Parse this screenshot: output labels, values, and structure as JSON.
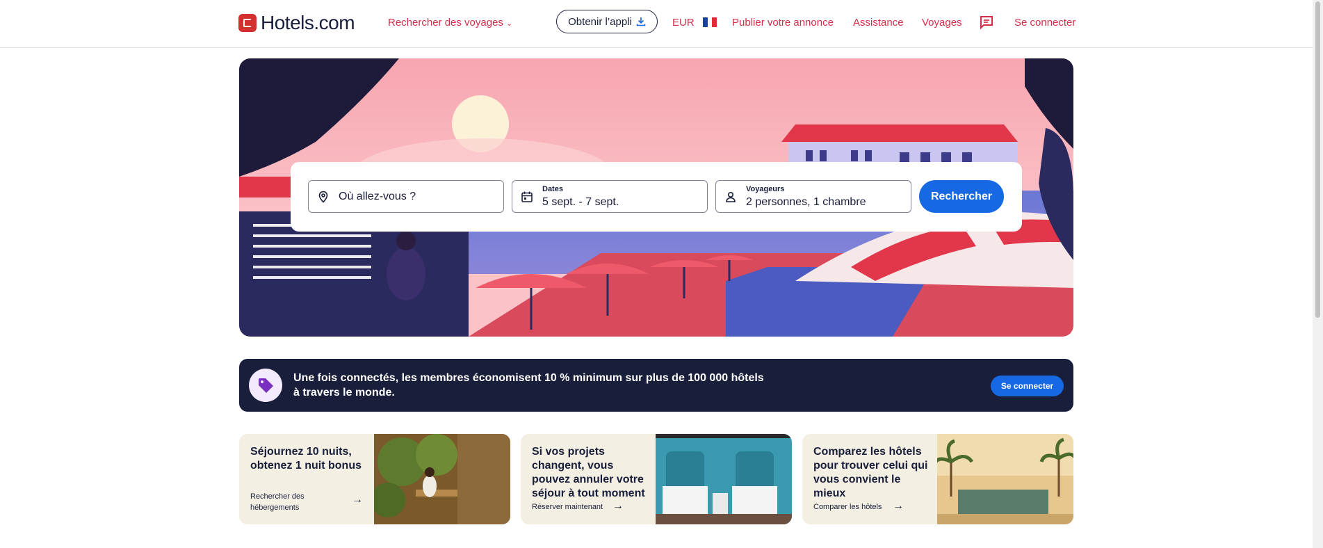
{
  "header": {
    "logo_text": "Hotels.com",
    "search_trips": "Rechercher des voyages",
    "get_app": "Obtenir l’appli",
    "currency": "EUR",
    "list_property": "Publier votre annonce",
    "support": "Assistance",
    "trips": "Voyages",
    "sign_in": "Se connecter"
  },
  "search": {
    "destination_placeholder": "Où allez-vous ?",
    "dates_label": "Dates",
    "dates_value": "5 sept. - 7 sept.",
    "travelers_label": "Voyageurs",
    "travelers_value": "2 personnes, 1 chambre",
    "submit": "Rechercher"
  },
  "banner": {
    "text": "Une fois connectés, les membres économisent 10 % minimum sur plus de 100 000 hôtels à travers le monde.",
    "button": "Se connecter"
  },
  "cards": [
    {
      "title": "Séjournez 10 nuits, obtenez 1 nuit bonus",
      "link": "Rechercher des hébergements"
    },
    {
      "title": "Si vos projets changent, vous pouvez annuler votre séjour à tout moment",
      "link": "Réserver maintenant"
    },
    {
      "title": "Comparez les hôtels pour trouver celui qui vous convient le mieux",
      "link": "Comparer les hôtels"
    }
  ],
  "colors": {
    "brand_red": "#d32f4a",
    "primary_blue": "#1668e3",
    "navy": "#191e3b"
  },
  "icons": [
    "logo-icon",
    "chevron-down-icon",
    "download-icon",
    "france-flag-icon",
    "chat-icon",
    "location-pin-icon",
    "calendar-icon",
    "person-icon",
    "tag-icon",
    "arrow-right-icon"
  ]
}
